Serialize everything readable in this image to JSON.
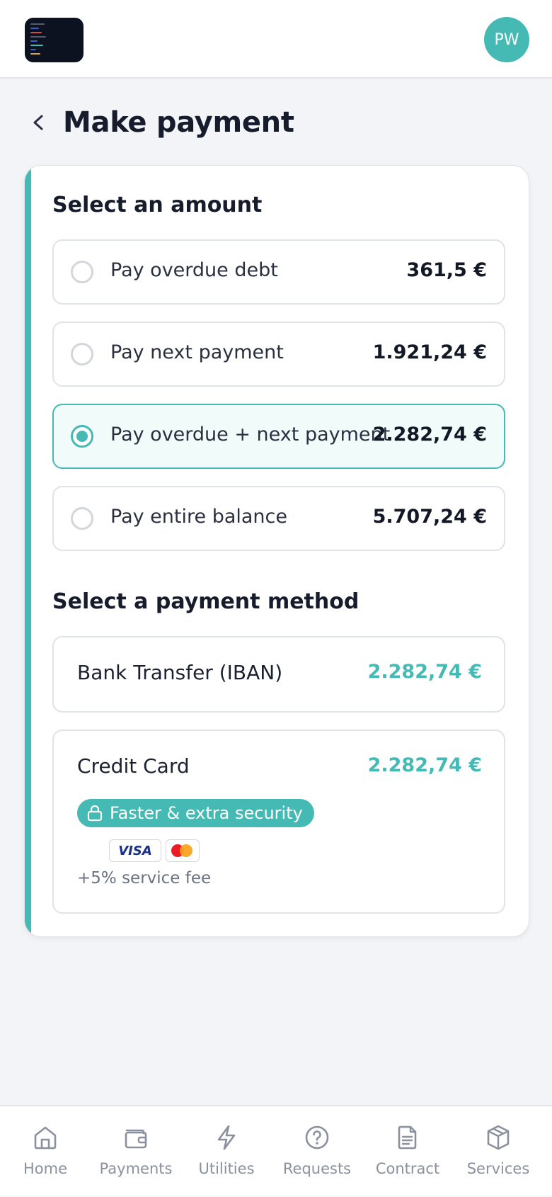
{
  "header": {
    "avatar_initials": "PW"
  },
  "page": {
    "title": "Make payment"
  },
  "amount_section": {
    "title": "Select an amount",
    "selected_index": 2,
    "options": [
      {
        "label": "Pay overdue debt",
        "amount": "361,5 €"
      },
      {
        "label": "Pay next payment",
        "amount": "1.921,24 €"
      },
      {
        "label": "Pay overdue + next payment",
        "amount": "2.282,74 €"
      },
      {
        "label": "Pay entire balance",
        "amount": "5.707,24 €"
      }
    ]
  },
  "method_section": {
    "title": "Select a payment method",
    "bank_transfer": {
      "label": "Bank Transfer (IBAN)",
      "amount": "2.282,74 €"
    },
    "credit_card": {
      "label": "Credit Card",
      "amount": "2.282,74 €",
      "badge": "Faster & extra security",
      "card_brands": [
        "VISA",
        "Mastercard"
      ],
      "visa_text": "VISA",
      "fee_note": "+5% service fee"
    }
  },
  "bottom_nav": [
    {
      "label": "Home",
      "icon": "home-icon"
    },
    {
      "label": "Payments",
      "icon": "wallet-icon"
    },
    {
      "label": "Utilities",
      "icon": "lightning-icon"
    },
    {
      "label": "Requests",
      "icon": "question-icon"
    },
    {
      "label": "Contract",
      "icon": "document-icon"
    },
    {
      "label": "Services",
      "icon": "box-icon"
    }
  ],
  "colors": {
    "accent": "#45bab4",
    "title_text": "#161c2c",
    "muted_text": "#8a909e",
    "selected_bg": "#f1fbfa",
    "page_bg": "#f3f4f7"
  }
}
